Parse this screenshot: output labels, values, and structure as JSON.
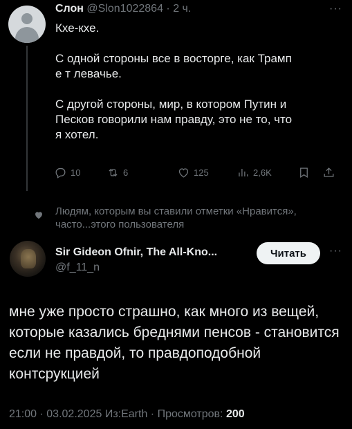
{
  "tweet": {
    "author_name": "Слон",
    "author_handle": "@Slon1022864",
    "time": "· 2 ч.",
    "more": "···",
    "paragraphs": [
      "Кхе-кхе.",
      "С одной стороны все в восторге, как Трамп\nе   т левачье.",
      "С другой стороны, мир, в котором Путин и\nПесков говорили нам правду, это не то, что\nя хотел."
    ],
    "actions": {
      "replies": "10",
      "reposts": "6",
      "likes": "125",
      "views": "2,6K"
    }
  },
  "hidden_notice": "Людям, которым вы ставили отметки «Нравится», часто...этого пользователя",
  "quote": {
    "author_name": "Sir Gideon Ofnir, The All-Kno...",
    "author_handle": "@f_11_n",
    "follow_label": "Читать",
    "more": "···",
    "text": "мне уже просто страшно, как много из вещей, которые казались бреднями пенсов - становится если не правдой, то правдоподобной контсрукцией",
    "time": "21:00",
    "date": "03.02.2025",
    "source": "Из:Earth",
    "views_label": "Просмотров:",
    "views_count": "200",
    "sep": "·"
  }
}
